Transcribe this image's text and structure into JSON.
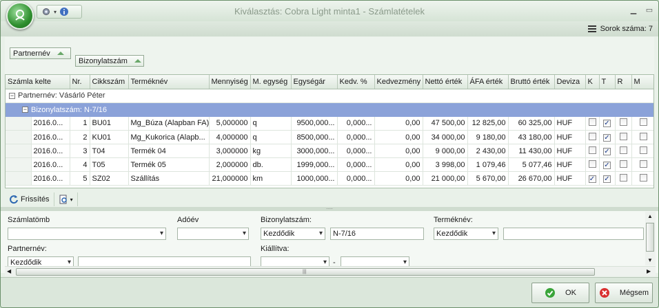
{
  "window": {
    "title": "Kiválasztás: Cobra Light minta1 - Számlatételek"
  },
  "rowcount": {
    "label": "Sorok száma: 7"
  },
  "grouping": {
    "chip1": "Partnernév",
    "chip2": "Bizonylatszám"
  },
  "grid": {
    "columns": [
      "Számla kelte",
      "Nr.",
      "Cikkszám",
      "Terméknév",
      "Mennyiség",
      "M. egység",
      "Egységár",
      "Kedv. %",
      "Kedvezmény",
      "Nettó érték",
      "ÁFA érték",
      "Bruttó érték",
      "Deviza",
      "K",
      "T",
      "R",
      "M"
    ],
    "group1": "Partnernév: Vásárló Péter",
    "group2": "Bizonylatszám: N-7/16",
    "rows": [
      {
        "date": "2016.0...",
        "nr": "1",
        "code": "BU01",
        "name": "Mg_Búza (Alapban FA)",
        "qty": "5,000000",
        "unit": "q",
        "price": "9500,000...",
        "disc_pct": "0,000...",
        "disc": "0,00",
        "net": "47 500,00",
        "vat": "12 825,00",
        "gross": "60 325,00",
        "cur": "HUF",
        "k": false,
        "t": true,
        "r": false,
        "m": false
      },
      {
        "date": "2016.0...",
        "nr": "2",
        "code": "KU01",
        "name": "Mg_Kukorica (Alapb...",
        "qty": "4,000000",
        "unit": "q",
        "price": "8500,000...",
        "disc_pct": "0,000...",
        "disc": "0,00",
        "net": "34 000,00",
        "vat": "9 180,00",
        "gross": "43 180,00",
        "cur": "HUF",
        "k": false,
        "t": true,
        "r": false,
        "m": false
      },
      {
        "date": "2016.0...",
        "nr": "3",
        "code": "T04",
        "name": "Termék 04",
        "qty": "3,000000",
        "unit": "kg",
        "price": "3000,000...",
        "disc_pct": "0,000...",
        "disc": "0,00",
        "net": "9 000,00",
        "vat": "2 430,00",
        "gross": "11 430,00",
        "cur": "HUF",
        "k": false,
        "t": true,
        "r": false,
        "m": false
      },
      {
        "date": "2016.0...",
        "nr": "4",
        "code": "T05",
        "name": "Termék 05",
        "qty": "2,000000",
        "unit": "db.",
        "price": "1999,000...",
        "disc_pct": "0,000...",
        "disc": "0,00",
        "net": "3 998,00",
        "vat": "1 079,46",
        "gross": "5 077,46",
        "cur": "HUF",
        "k": false,
        "t": true,
        "r": false,
        "m": false
      },
      {
        "date": "2016.0...",
        "nr": "5",
        "code": "SZ02",
        "name": "Szállítás",
        "qty": "21,000000",
        "unit": "km",
        "price": "1000,000...",
        "disc_pct": "0,000...",
        "disc": "0,00",
        "net": "21 000,00",
        "vat": "5 670,00",
        "gross": "26 670,00",
        "cur": "HUF",
        "k": true,
        "t": true,
        "r": false,
        "m": false
      }
    ]
  },
  "toolbar": {
    "refresh": "Frissítés"
  },
  "filter": {
    "szamlatomb_label": "Számlatömb",
    "szamlatomb_value": "",
    "adoev_label": "Adóév",
    "adoev_value": "",
    "bizonylat_label": "Bizonylatszám:",
    "bizonylat_op": "Kezdődik",
    "bizonylat_value": "N-7/16",
    "termeknev_label": "Terméknév:",
    "termeknev_op": "Kezdődik",
    "termeknev_value": "",
    "partnernev_label": "Partnernév:",
    "partnernev_op": "Kezdődik",
    "partnernev_value": "",
    "kiallitva_label": "Kiállítva:",
    "kiallitva_from": "",
    "kiallitva_dash": "-",
    "kiallitva_to": ""
  },
  "buttons": {
    "ok": "OK",
    "cancel": "Mégsem"
  },
  "colors": {
    "group_highlight": "#8ba2d9",
    "ok_icon": "#3aa53a",
    "cancel_icon": "#d93030"
  }
}
